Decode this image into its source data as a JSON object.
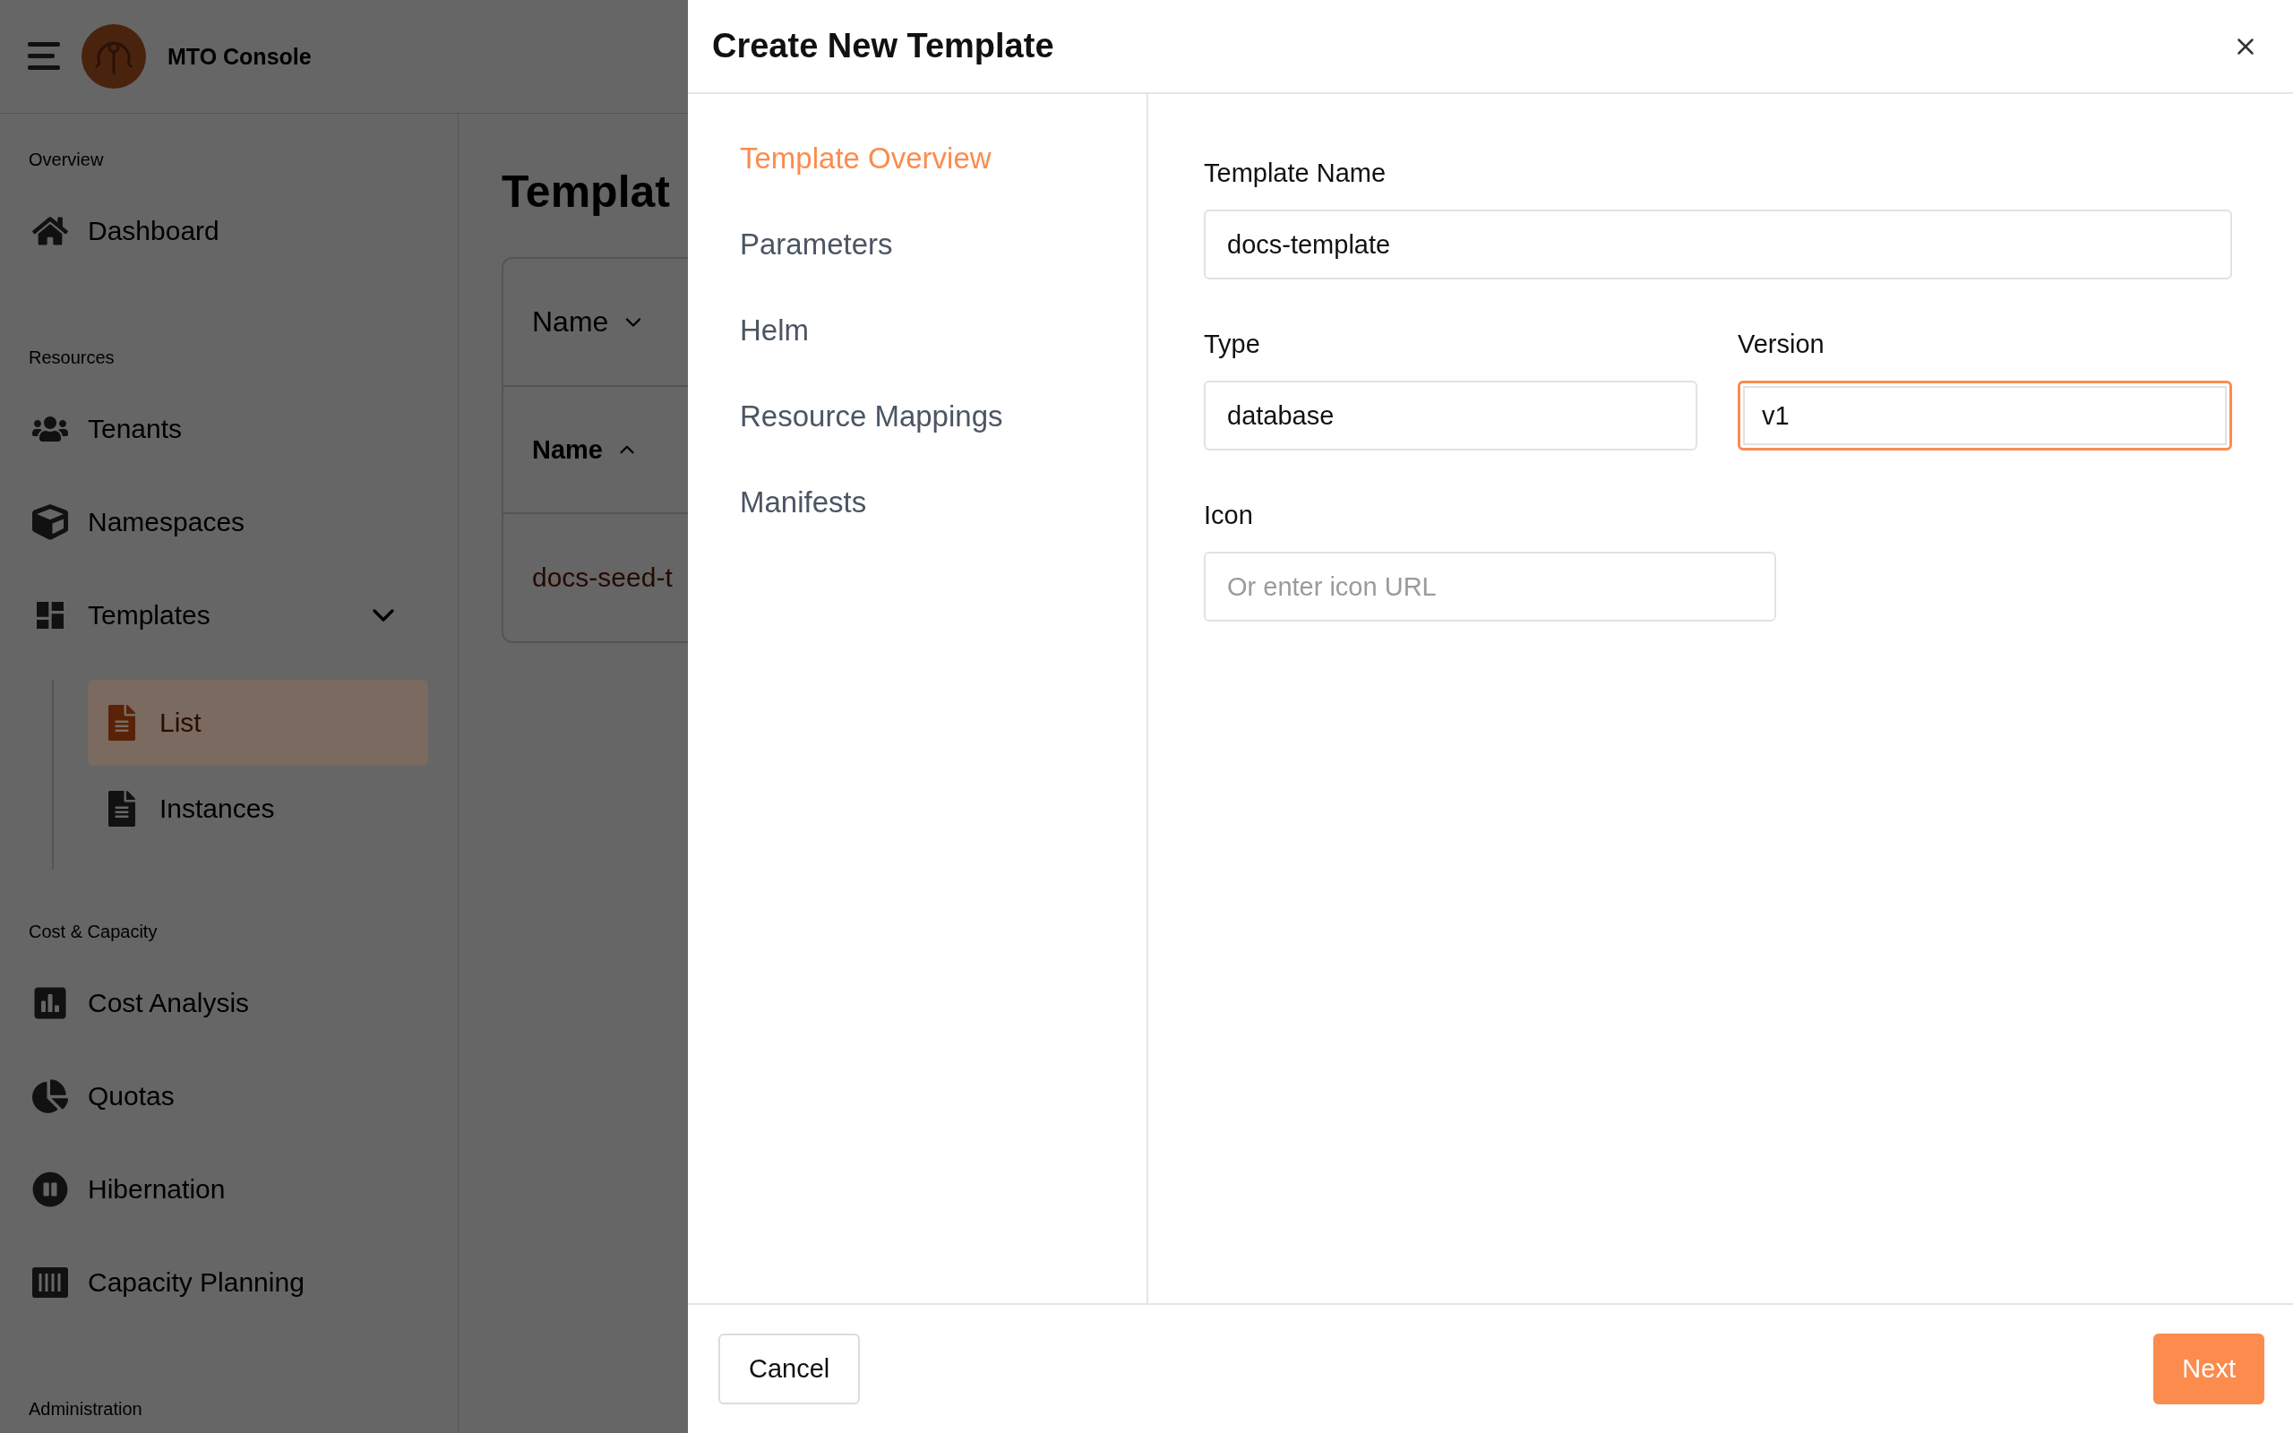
{
  "app": {
    "title": "MTO Console"
  },
  "sidebar": {
    "sections": [
      {
        "label": "Overview",
        "items": [
          {
            "label": "Dashboard",
            "selected": false
          }
        ]
      },
      {
        "label": "Resources",
        "items": [
          {
            "label": "Tenants",
            "selected": false
          },
          {
            "label": "Namespaces",
            "selected": false
          },
          {
            "label": "Templates",
            "selected": false,
            "expanded": true,
            "children": [
              {
                "label": "List",
                "selected": true
              },
              {
                "label": "Instances",
                "selected": false
              }
            ]
          }
        ]
      },
      {
        "label": "Cost & Capacity",
        "items": [
          {
            "label": "Cost Analysis",
            "selected": false
          },
          {
            "label": "Quotas",
            "selected": false
          },
          {
            "label": "Hibernation",
            "selected": false
          },
          {
            "label": "Capacity Planning",
            "selected": false
          }
        ]
      },
      {
        "label": "Administration"
      }
    ]
  },
  "main": {
    "title": "Templat",
    "table": {
      "filter_label": "Name",
      "column": {
        "label": "Name",
        "ascending": true
      },
      "rows": [
        {
          "name": "docs-seed-t"
        }
      ]
    }
  },
  "dialog": {
    "title": "Create New Template",
    "steps": [
      {
        "label": "Template Overview",
        "selected": true
      },
      {
        "label": "Parameters",
        "selected": false
      },
      {
        "label": "Helm",
        "selected": false
      },
      {
        "label": "Resource Mappings",
        "selected": false
      },
      {
        "label": "Manifests",
        "selected": false
      }
    ],
    "fields": [
      {
        "label": "Template Name",
        "value": "docs-template",
        "focused": false
      },
      {
        "label": "Type",
        "value": "database",
        "focused": false
      },
      {
        "label": "Version",
        "value": "v1",
        "focused": true
      },
      {
        "label": "Icon",
        "placeholder": "Or enter icon URL",
        "focused": false
      }
    ],
    "buttons": {
      "cancel": "Cancel",
      "next": "Next"
    }
  }
}
